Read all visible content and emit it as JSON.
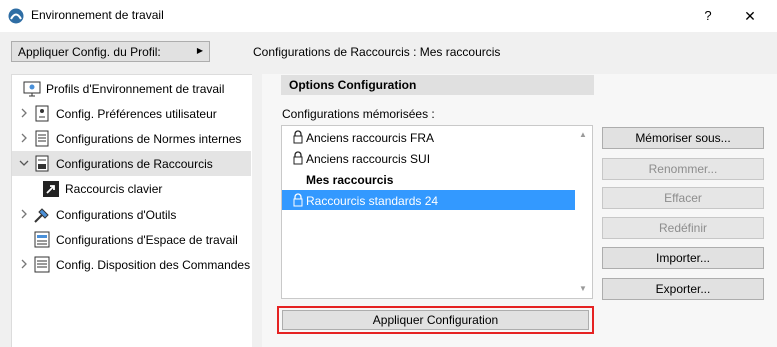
{
  "window": {
    "title": "Environnement de travail",
    "help_label": "?",
    "close_label": "✕"
  },
  "profile_dropdown": {
    "label": "Appliquer Config. du Profil:",
    "arrow": "▶"
  },
  "config_header": "Configurations de Raccourcis :  Mes raccourcis",
  "tree": {
    "items": [
      {
        "label": "Profils d'Environnement de travail",
        "icon": "profile-icon",
        "expandable": false
      },
      {
        "label": "Config. Préférences utilisateur",
        "icon": "preferences-icon",
        "expandable": true
      },
      {
        "label": "Configurations de Normes  internes",
        "icon": "standards-icon",
        "expandable": true
      },
      {
        "label": "Configurations de Raccourcis",
        "icon": "shortcuts-icon",
        "expandable": true,
        "expanded": true,
        "selected": true
      },
      {
        "label": "Raccourcis clavier",
        "icon": "keyboard-shortcut-icon",
        "expandable": false
      },
      {
        "label": "Configurations d'Outils",
        "icon": "tools-icon",
        "expandable": true
      },
      {
        "label": "Configurations d'Espace de travail",
        "icon": "workspace-icon",
        "expandable": false
      },
      {
        "label": "Config. Disposition des Commandes",
        "icon": "command-layout-icon",
        "expandable": true
      }
    ]
  },
  "options": {
    "title": "Options Configuration",
    "list_caption": "Configurations mémorisées :",
    "items": [
      {
        "label": "Anciens raccourcis FRA",
        "locked": true
      },
      {
        "label": "Anciens raccourcis SUI",
        "locked": true
      },
      {
        "label": "Mes raccourcis",
        "locked": false,
        "bold": true
      },
      {
        "label": "Raccourcis standards 24",
        "locked": true,
        "selected": true
      }
    ],
    "buttons": {
      "store": "Mémoriser sous...",
      "rename": "Renommer...",
      "delete": "Effacer",
      "redefine": "Redéfinir",
      "import": "Importer...",
      "export": "Exporter..."
    },
    "apply": "Appliquer Configuration"
  },
  "colors": {
    "selection": "#3399ff",
    "highlight_outline": "#e52222",
    "app_icon": "#2e6da4"
  }
}
